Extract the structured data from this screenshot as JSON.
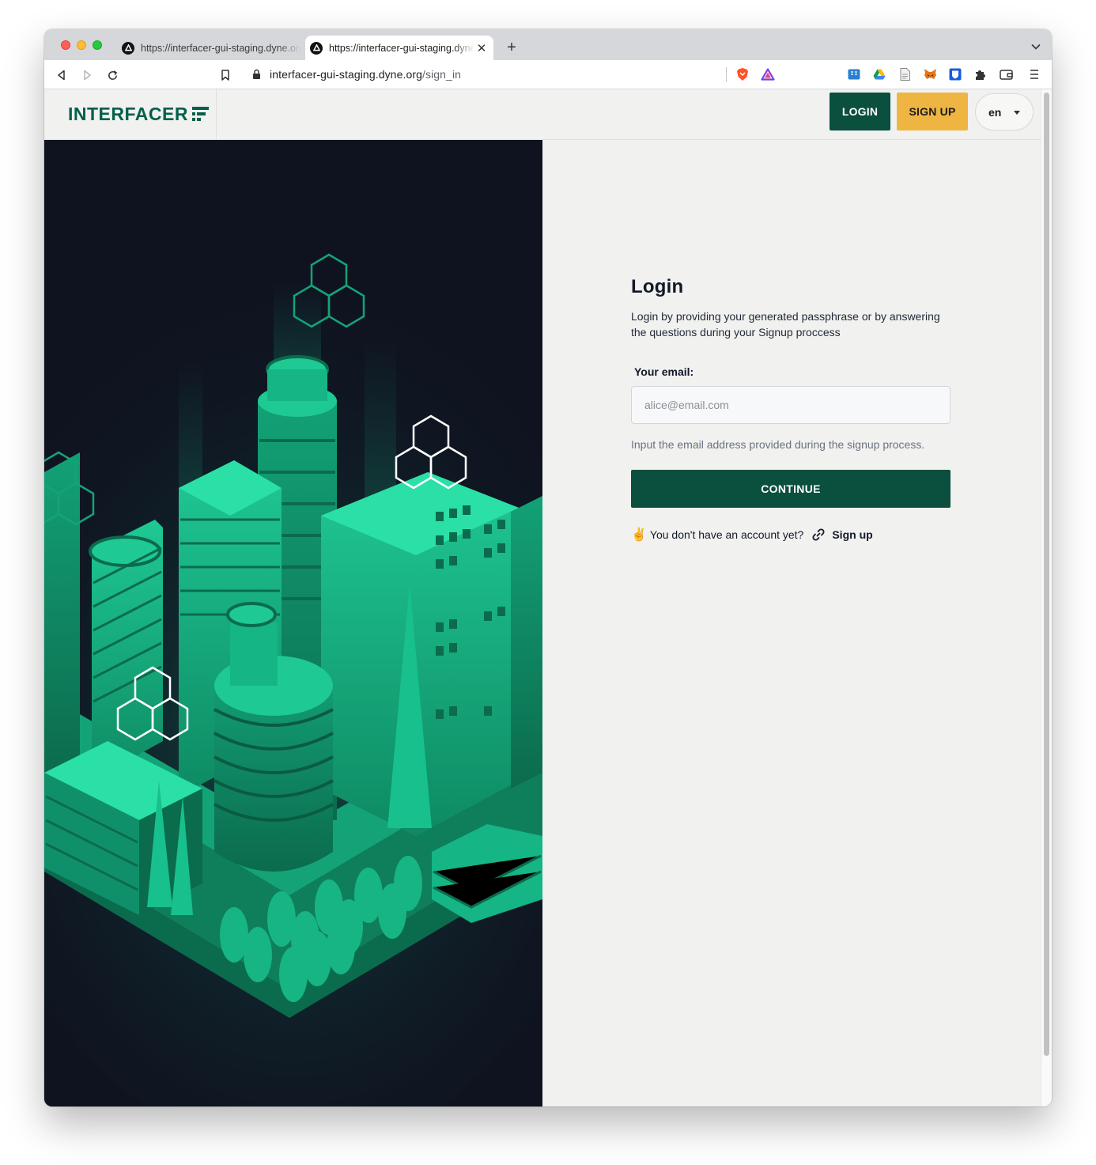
{
  "browser": {
    "tabs": [
      {
        "title": "https://interfacer-gui-staging.dyne.org/sign_in",
        "active": false
      },
      {
        "title": "https://interfacer-gui-staging.dyne.org/sign_in",
        "active": true
      }
    ],
    "url_host": "interfacer-gui-staging.dyne.org",
    "url_path": "/sign_in"
  },
  "header": {
    "logo_text": "INTERFACER",
    "login_label": "LOGIN",
    "signup_label": "SIGN UP",
    "language": "en"
  },
  "login": {
    "title": "Login",
    "subtitle": "Login by providing your generated passphrase or by answering the questions during your Signup proccess",
    "email_label": "Your email:",
    "email_placeholder": "alice@email.com",
    "email_value": "",
    "email_help": "Input the email address provided during the signup process.",
    "continue_label": "CONTINUE",
    "no_account_emoji": "✌️",
    "no_account_text": "You don't have an account yet?",
    "signup_link": "Sign up"
  },
  "colors": {
    "brand_green": "#0b4f3e",
    "accent_yellow": "#efb542",
    "hero_background": "#0f1320",
    "hero_city": "#14b584"
  }
}
